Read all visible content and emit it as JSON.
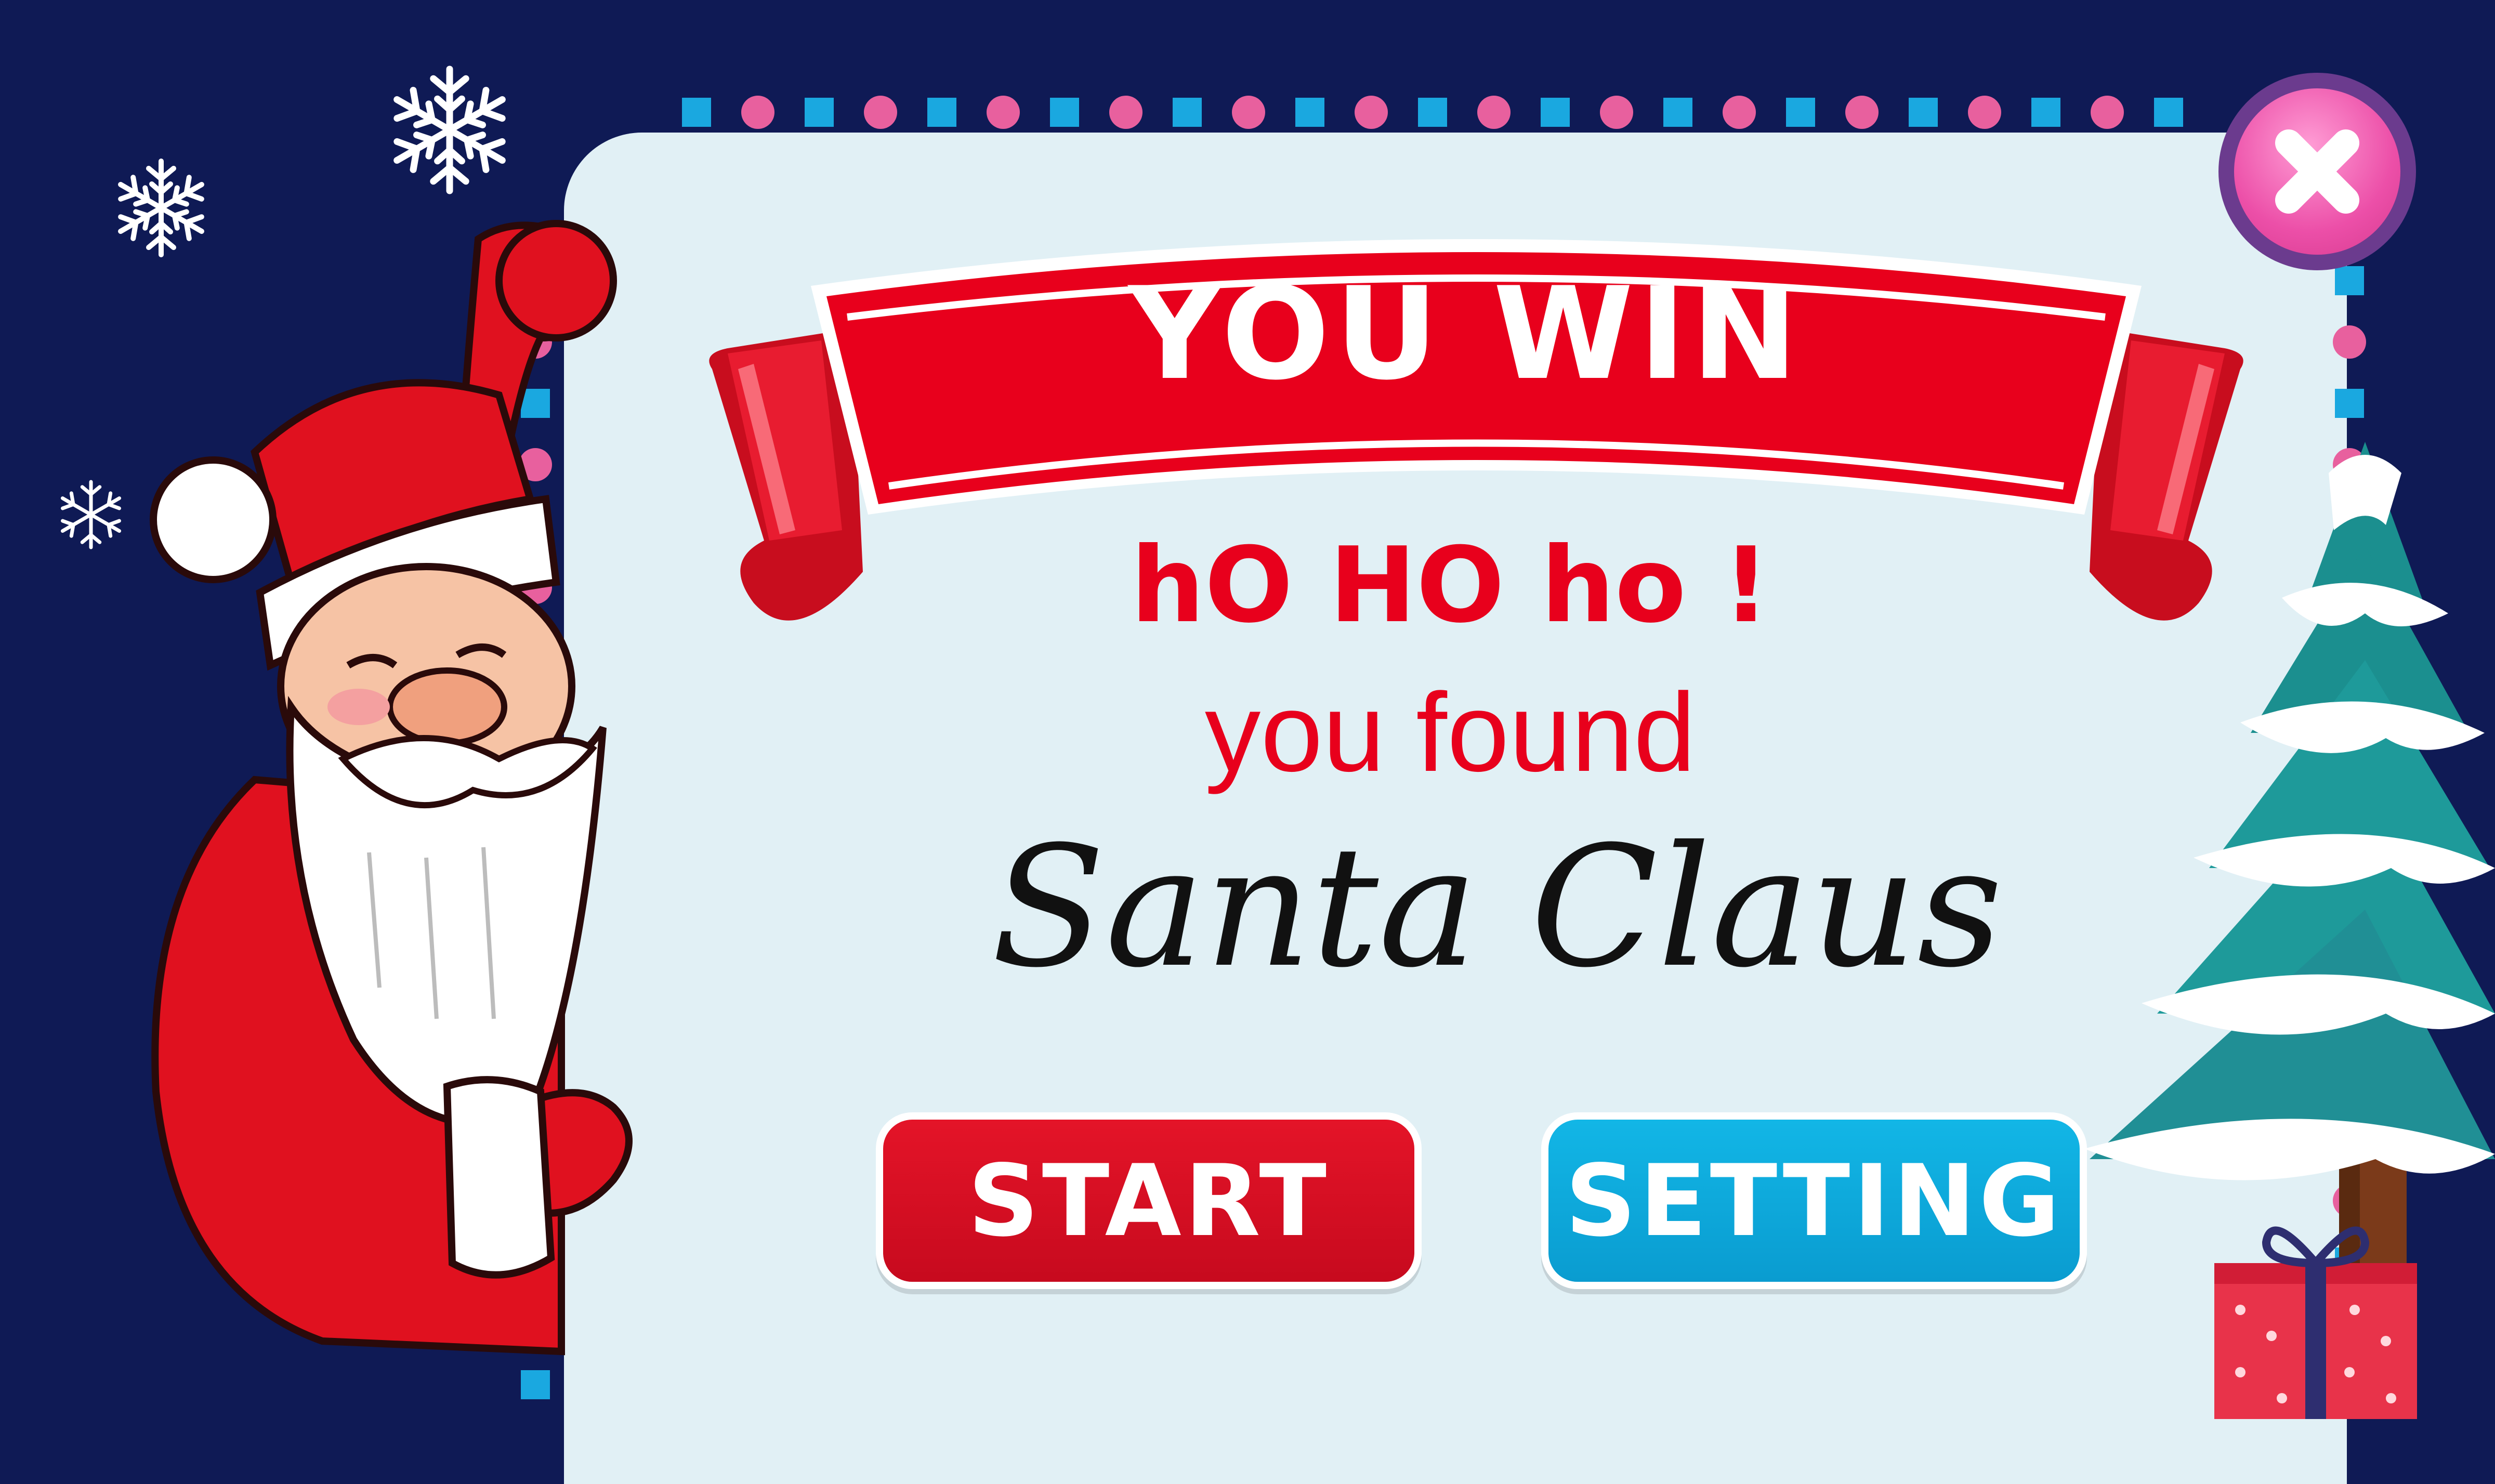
{
  "screen": {
    "ribbon_title": "YOU WIN",
    "exclamation": "hO HO ho !",
    "found_line": "you found",
    "character_name": "Santa Claus"
  },
  "buttons": {
    "start_label": "START",
    "setting_label": "SETTING"
  },
  "icons": {
    "close": "close-icon",
    "snowflake": "snowflake-icon",
    "santa": "santa-claus-illustration",
    "tree": "christmas-tree-illustration",
    "gift": "gift-box-icon"
  },
  "colors": {
    "background": "#0f1a55",
    "panel": "#e1f0f5",
    "ribbon_red": "#e8001c",
    "start_red": "#e41428",
    "setting_blue": "#12b6e6",
    "close_pink": "#ec4fa8",
    "frame_cyan": "#1aa8e0",
    "frame_pink": "#e8609e"
  }
}
